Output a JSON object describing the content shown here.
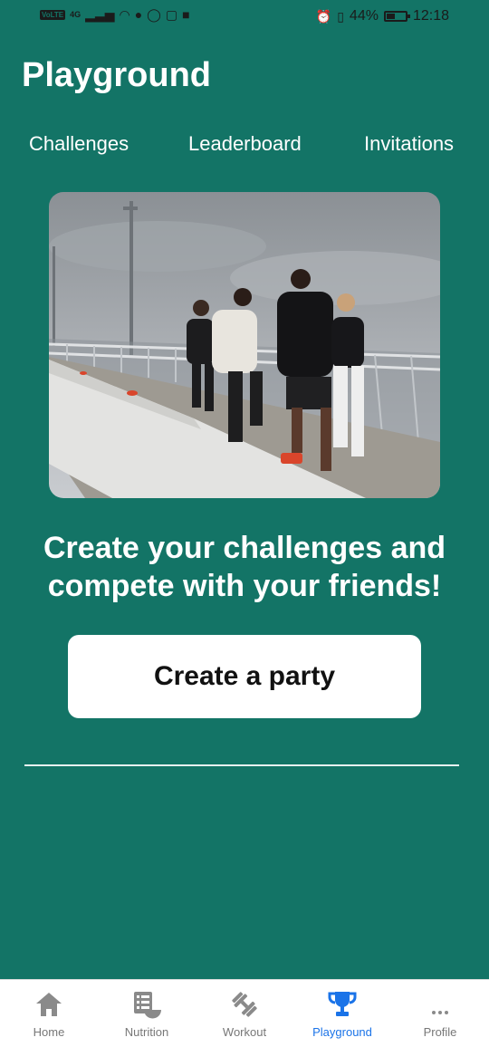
{
  "statusbar": {
    "network": "4G",
    "volte": "VoLTE",
    "battery_percent": "44%",
    "battery_level": 0.44,
    "time": "12:18"
  },
  "header": {
    "title": "Playground"
  },
  "tabs": [
    {
      "label": "Challenges"
    },
    {
      "label": "Leaderboard"
    },
    {
      "label": "Invitations"
    }
  ],
  "hero": {
    "image": "group-of-runners-on-bridge-photo"
  },
  "main": {
    "headline": "Create your challenges and compete with your friends!",
    "cta_label": "Create a party"
  },
  "bottom_nav": {
    "active": "Playground",
    "active_color": "#1a73e8",
    "items": [
      {
        "label": "Home",
        "icon": "home-icon"
      },
      {
        "label": "Nutrition",
        "icon": "nutrition-icon"
      },
      {
        "label": "Workout",
        "icon": "dumbbell-icon"
      },
      {
        "label": "Playground",
        "icon": "trophy-icon"
      },
      {
        "label": "Profile",
        "icon": "more-horizontal-icon"
      }
    ]
  },
  "colors": {
    "background": "#137466",
    "card": "#ffffff"
  }
}
